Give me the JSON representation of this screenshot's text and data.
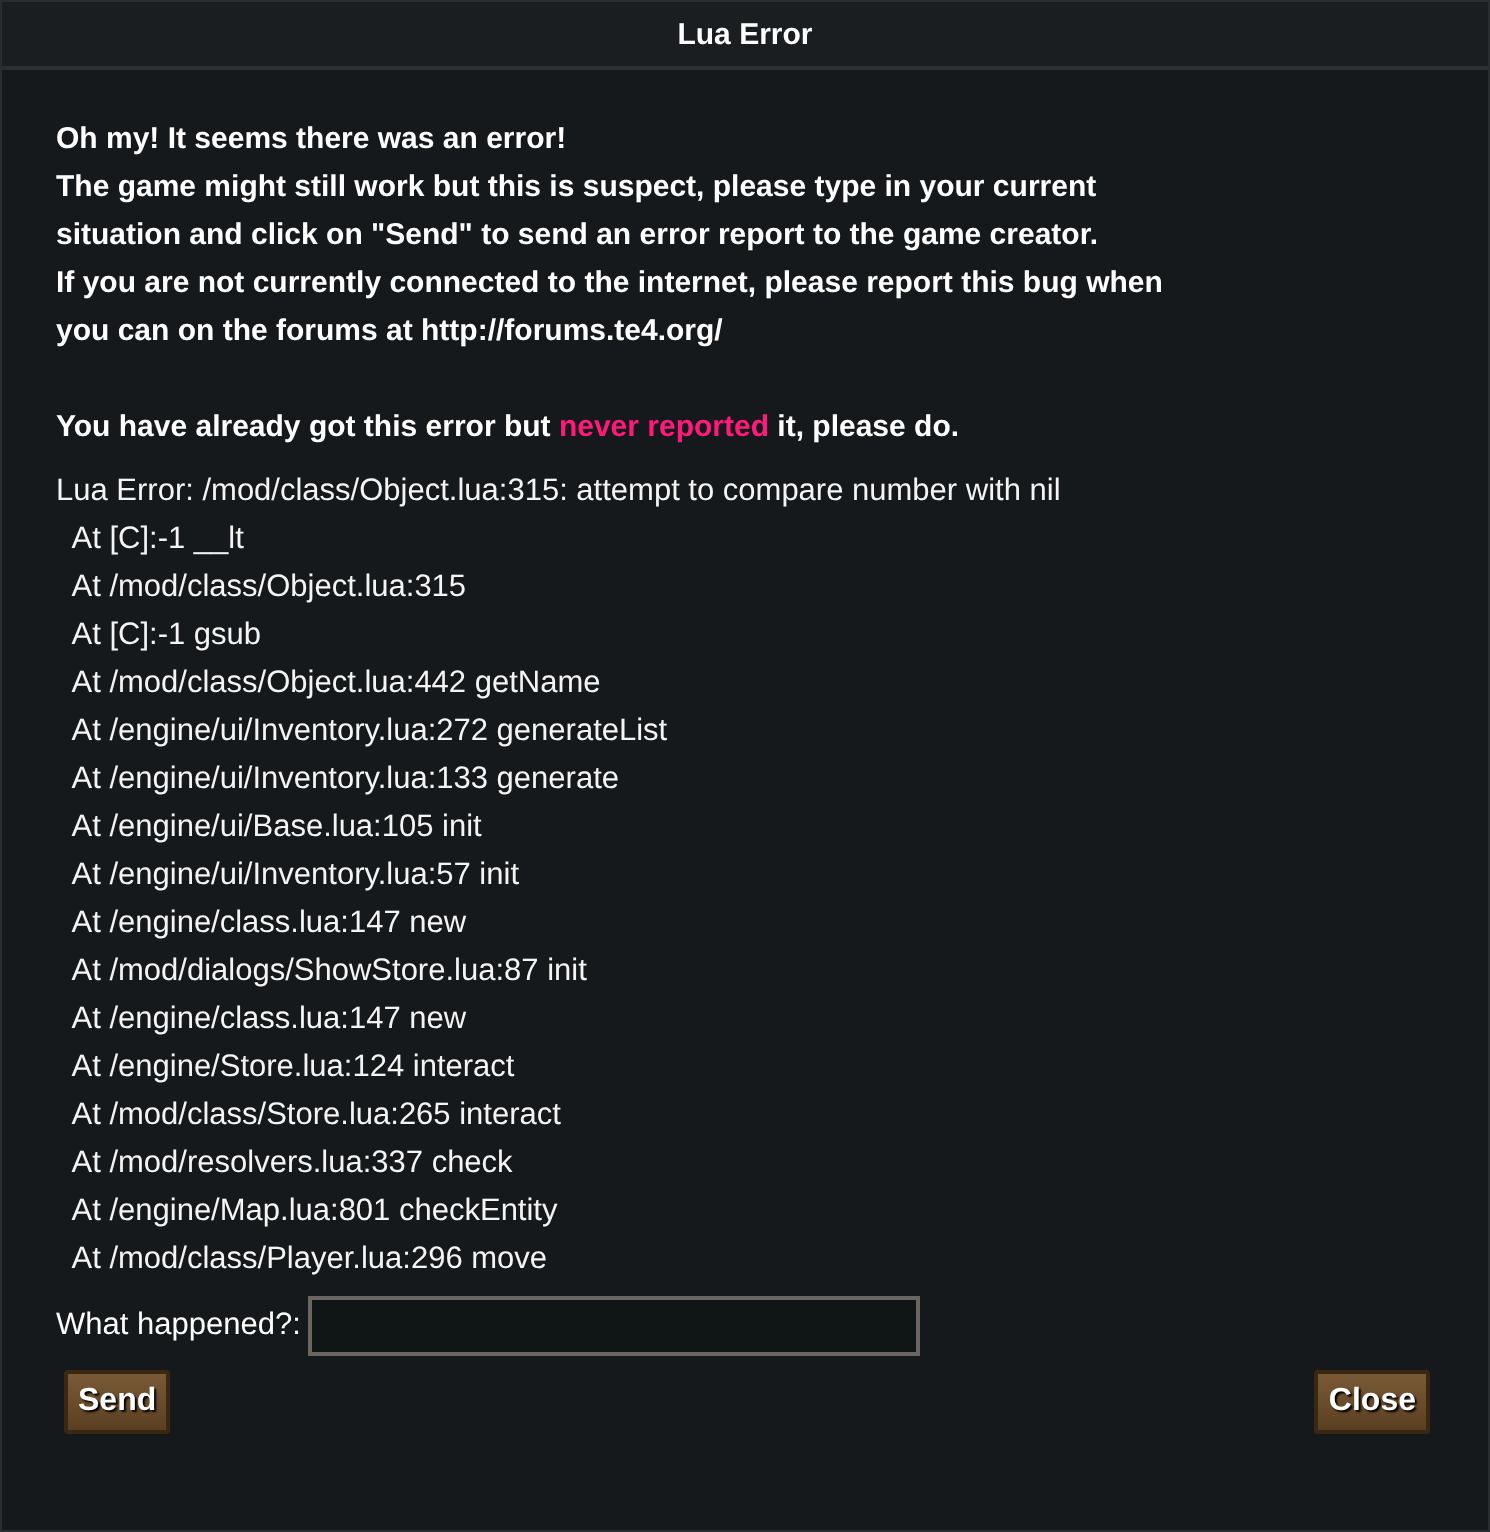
{
  "window": {
    "title": "Lua Error"
  },
  "message_lines": [
    "Oh my! It seems there was an error!",
    "The game might still work but this is suspect, please type in your current",
    "situation and click on \"Send\" to send an error report to the game creator.",
    "If you are not currently connected to the internet, please report this bug when",
    "you can on the forums at http://forums.te4.org/"
  ],
  "notice": {
    "parts": [
      {
        "text": "You have already got this error but ",
        "highlight": false
      },
      {
        "text": "never reported",
        "highlight": true
      },
      {
        "text": " it, please do.",
        "highlight": false
      }
    ]
  },
  "trace_lines": [
    "Lua Error: /mod/class/Object.lua:315: attempt to compare number with nil",
    "  At [C]:-1 __lt",
    "  At /mod/class/Object.lua:315",
    "  At [C]:-1 gsub",
    "  At /mod/class/Object.lua:442 getName",
    "  At /engine/ui/Inventory.lua:272 generateList",
    "  At /engine/ui/Inventory.lua:133 generate",
    "  At /engine/ui/Base.lua:105 init",
    "  At /engine/ui/Inventory.lua:57 init",
    "  At /engine/class.lua:147 new",
    "  At /mod/dialogs/ShowStore.lua:87 init",
    "  At /engine/class.lua:147 new",
    "  At /engine/Store.lua:124 interact",
    "  At /mod/class/Store.lua:265 interact",
    "  At /mod/resolvers.lua:337 check",
    "  At /engine/Map.lua:801 checkEntity",
    "  At /mod/class/Player.lua:296 move"
  ],
  "report_field": {
    "label": "What happened?:"
  },
  "buttons": [
    "Send",
    "Close"
  ]
}
